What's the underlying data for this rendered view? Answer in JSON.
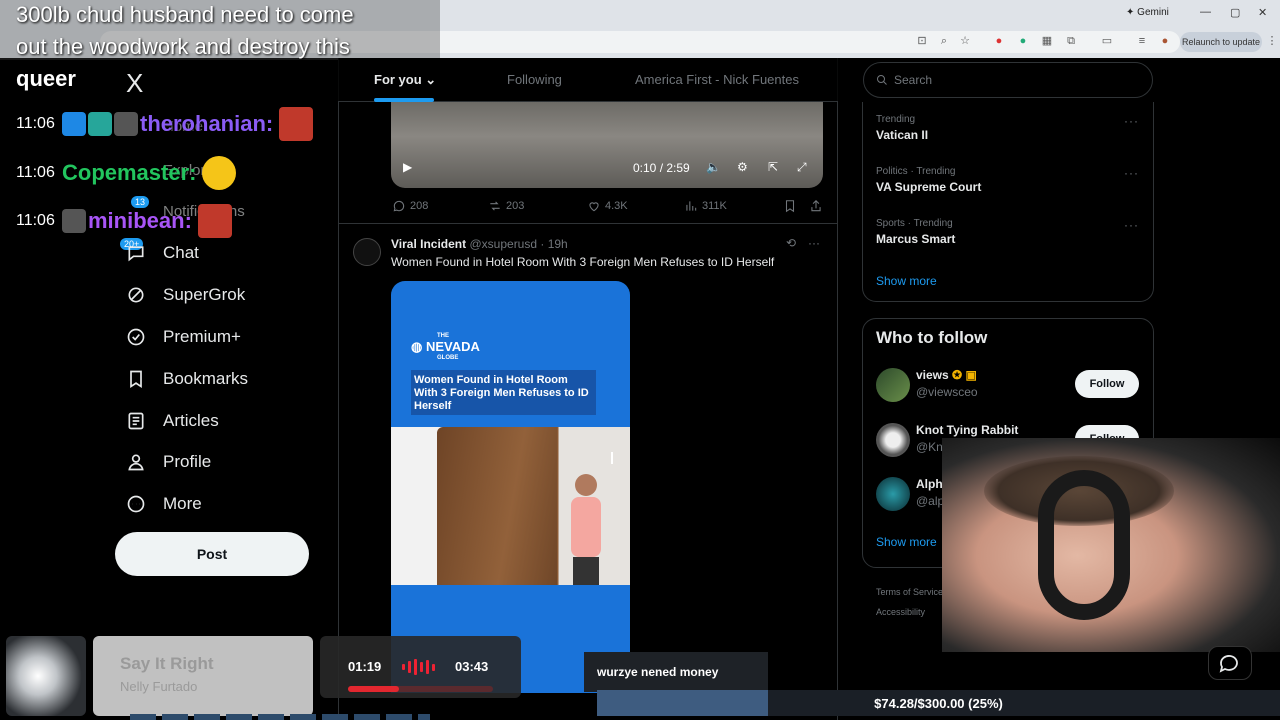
{
  "browser": {
    "gemini_label": "Gemini",
    "relaunch_label": "Relaunch to update",
    "window_controls": [
      "—",
      "▢",
      "✕"
    ]
  },
  "overlay": {
    "message_lines": [
      "300lb chud husband need to come",
      "out the woodwork and destroy this",
      "queer"
    ],
    "chat": [
      {
        "time": "11:06",
        "name": "therohanian:",
        "color": "#8b5cf6"
      },
      {
        "time": "11:06",
        "name": "Copemaster:",
        "color": "#22c55e"
      },
      {
        "time": "11:06",
        "name": "minibean:",
        "color": "#a855f7"
      }
    ]
  },
  "nav": {
    "logo": "X",
    "ghost_items": [
      "Home",
      "Explore",
      "Notifications"
    ],
    "notifications_badge": "13",
    "chat_badge": "20+",
    "items": [
      {
        "label": "Chat",
        "icon": "chat-icon"
      },
      {
        "label": "SuperGrok",
        "icon": "grok-icon"
      },
      {
        "label": "Premium+",
        "icon": "verified-icon"
      },
      {
        "label": "Bookmarks",
        "icon": "bookmark-icon"
      },
      {
        "label": "Articles",
        "icon": "article-icon"
      },
      {
        "label": "Profile",
        "icon": "profile-icon"
      },
      {
        "label": "More",
        "icon": "more-icon"
      }
    ],
    "post_label": "Post"
  },
  "tabs": [
    {
      "label": "For you",
      "active": true
    },
    {
      "label": "Following",
      "active": false
    },
    {
      "label": "America First - Nick Fuentes",
      "active": false
    }
  ],
  "video": {
    "time": "0:10 / 2:59"
  },
  "prev_tweet_actions": {
    "replies": "208",
    "reposts": "203",
    "likes": "4.3K",
    "views": "311K"
  },
  "tweet": {
    "author": "Viral Incident",
    "handle": "@xsuperusd",
    "time": "· 19h",
    "text": "Women Found in Hotel Room With 3 Foreign Men Refuses to ID Herself",
    "media_logo": "NEVADA",
    "media_logo_small": "THE",
    "media_logo_sub": "GLOBE",
    "media_headline": "Women Found in Hotel Room With 3 Foreign Men Refuses to ID Herself"
  },
  "right": {
    "search_placeholder": "Search",
    "trends": [
      {
        "meta": "Trending",
        "name": "Vatican II"
      },
      {
        "meta": "Politics · Trending",
        "name": "VA Supreme Court"
      },
      {
        "meta": "Sports · Trending",
        "name": "Marcus Smart"
      }
    ],
    "show_more": "Show more",
    "who_to_follow": "Who to follow",
    "follow": [
      {
        "name": "views",
        "handle": "@viewsceo",
        "button": "Follow"
      },
      {
        "name": "Knot Tying Rabbit",
        "handle": "@KnotTyingRabbit",
        "button": "Follow"
      },
      {
        "name": "AlphaFox",
        "handle": "@alphafo",
        "button": ""
      }
    ],
    "footer": [
      "Terms of Service",
      "Accessibility"
    ]
  },
  "music": {
    "title": "Say It Right",
    "artist": "Nelly Furtado",
    "current": "01:19",
    "total": "03:43",
    "progress": 0.354
  },
  "donation": {
    "message": "wurzye nened money",
    "goal_text": "$74.28/$300.00 (25%)",
    "goal_fraction": 0.25
  }
}
